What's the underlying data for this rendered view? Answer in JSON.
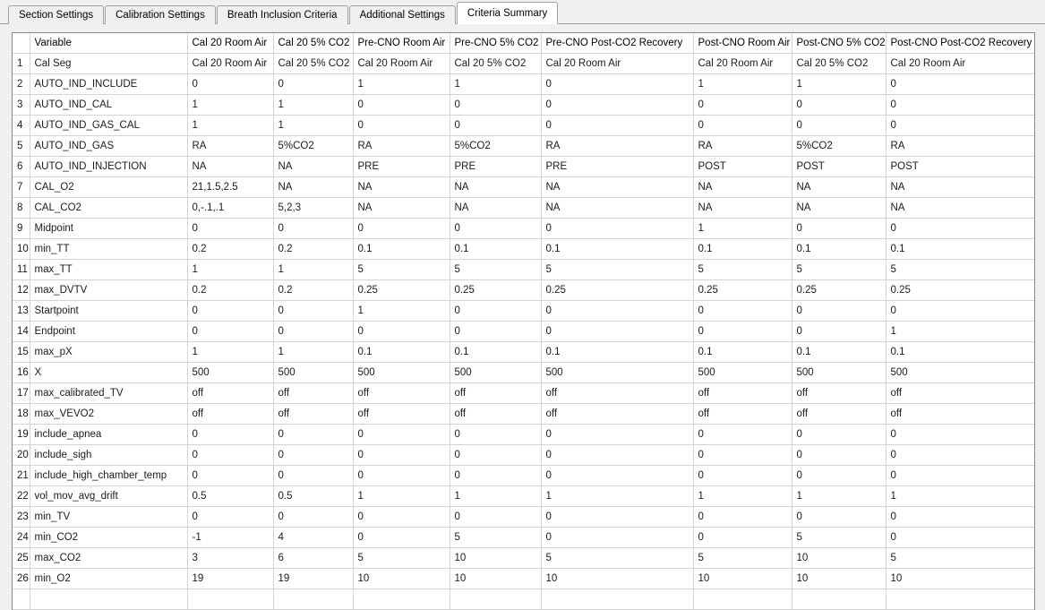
{
  "window": {
    "title": "Criteria Summary"
  },
  "tabs": [
    {
      "label": "Section Settings",
      "selected": false
    },
    {
      "label": "Calibration Settings",
      "selected": false
    },
    {
      "label": "Breath Inclusion Criteria",
      "selected": false
    },
    {
      "label": "Additional Settings",
      "selected": false
    },
    {
      "label": "Criteria Summary",
      "selected": true
    }
  ],
  "table": {
    "rownum_header": "",
    "variable_header": "Variable",
    "column_headers": [
      "Cal 20 Room Air",
      "Cal 20 5% CO2",
      "Pre-CNO Room Air",
      "Pre-CNO 5% CO2",
      "Pre-CNO Post-CO2 Recovery",
      "Post-CNO Room Air",
      "Post-CNO 5% CO2",
      "Post-CNO Post-CO2 Recovery"
    ],
    "rows": [
      {
        "num": "1",
        "variable": "Cal Seg",
        "values": [
          "Cal 20 Room Air",
          "Cal 20 5% CO2",
          "Cal 20 Room Air",
          "Cal 20 5% CO2",
          "Cal 20 Room Air",
          "Cal 20 Room Air",
          "Cal 20 5% CO2",
          "Cal 20 Room Air"
        ]
      },
      {
        "num": "2",
        "variable": "AUTO_IND_INCLUDE",
        "values": [
          "0",
          "0",
          "1",
          "1",
          "0",
          "1",
          "1",
          "0"
        ]
      },
      {
        "num": "3",
        "variable": "AUTO_IND_CAL",
        "values": [
          "1",
          "1",
          "0",
          "0",
          "0",
          "0",
          "0",
          "0"
        ]
      },
      {
        "num": "4",
        "variable": "AUTO_IND_GAS_CAL",
        "values": [
          "1",
          "1",
          "0",
          "0",
          "0",
          "0",
          "0",
          "0"
        ]
      },
      {
        "num": "5",
        "variable": "AUTO_IND_GAS",
        "values": [
          "RA",
          "5%CO2",
          "RA",
          "5%CO2",
          "RA",
          "RA",
          "5%CO2",
          "RA"
        ]
      },
      {
        "num": "6",
        "variable": "AUTO_IND_INJECTION",
        "values": [
          "NA",
          "NA",
          "PRE",
          "PRE",
          "PRE",
          "POST",
          "POST",
          "POST"
        ]
      },
      {
        "num": "7",
        "variable": "CAL_O2",
        "values": [
          "21,1.5,2.5",
          "NA",
          "NA",
          "NA",
          "NA",
          "NA",
          "NA",
          "NA"
        ]
      },
      {
        "num": "8",
        "variable": "CAL_CO2",
        "values": [
          "0,-.1,.1",
          "5,2,3",
          "NA",
          "NA",
          "NA",
          "NA",
          "NA",
          "NA"
        ]
      },
      {
        "num": "9",
        "variable": "Midpoint",
        "values": [
          "0",
          "0",
          "0",
          "0",
          "0",
          "1",
          "0",
          "0"
        ]
      },
      {
        "num": "10",
        "variable": "min_TT",
        "values": [
          "0.2",
          "0.2",
          "0.1",
          "0.1",
          "0.1",
          "0.1",
          "0.1",
          "0.1"
        ]
      },
      {
        "num": "11",
        "variable": "max_TT",
        "values": [
          "1",
          "1",
          "5",
          "5",
          "5",
          "5",
          "5",
          "5"
        ]
      },
      {
        "num": "12",
        "variable": "max_DVTV",
        "values": [
          "0.2",
          "0.2",
          "0.25",
          "0.25",
          "0.25",
          "0.25",
          "0.25",
          "0.25"
        ]
      },
      {
        "num": "13",
        "variable": "Startpoint",
        "values": [
          "0",
          "0",
          "1",
          "0",
          "0",
          "0",
          "0",
          "0"
        ]
      },
      {
        "num": "14",
        "variable": "Endpoint",
        "values": [
          "0",
          "0",
          "0",
          "0",
          "0",
          "0",
          "0",
          "1"
        ]
      },
      {
        "num": "15",
        "variable": "max_pX",
        "values": [
          "1",
          "1",
          "0.1",
          "0.1",
          "0.1",
          "0.1",
          "0.1",
          "0.1"
        ]
      },
      {
        "num": "16",
        "variable": "X",
        "values": [
          "500",
          "500",
          "500",
          "500",
          "500",
          "500",
          "500",
          "500"
        ]
      },
      {
        "num": "17",
        "variable": "max_calibrated_TV",
        "values": [
          "off",
          "off",
          "off",
          "off",
          "off",
          "off",
          "off",
          "off"
        ]
      },
      {
        "num": "18",
        "variable": "max_VEVO2",
        "values": [
          "off",
          "off",
          "off",
          "off",
          "off",
          "off",
          "off",
          "off"
        ]
      },
      {
        "num": "19",
        "variable": "include_apnea",
        "values": [
          "0",
          "0",
          "0",
          "0",
          "0",
          "0",
          "0",
          "0"
        ]
      },
      {
        "num": "20",
        "variable": "include_sigh",
        "values": [
          "0",
          "0",
          "0",
          "0",
          "0",
          "0",
          "0",
          "0"
        ]
      },
      {
        "num": "21",
        "variable": "include_high_chamber_temp",
        "values": [
          "0",
          "0",
          "0",
          "0",
          "0",
          "0",
          "0",
          "0"
        ]
      },
      {
        "num": "22",
        "variable": "vol_mov_avg_drift",
        "values": [
          "0.5",
          "0.5",
          "1",
          "1",
          "1",
          "1",
          "1",
          "1"
        ]
      },
      {
        "num": "23",
        "variable": "min_TV",
        "values": [
          "0",
          "0",
          "0",
          "0",
          "0",
          "0",
          "0",
          "0"
        ]
      },
      {
        "num": "24",
        "variable": "min_CO2",
        "values": [
          "-1",
          "4",
          "0",
          "5",
          "0",
          "0",
          "5",
          "0"
        ]
      },
      {
        "num": "25",
        "variable": "max_CO2",
        "values": [
          "3",
          "6",
          "5",
          "10",
          "5",
          "5",
          "10",
          "5"
        ]
      },
      {
        "num": "26",
        "variable": "min_O2",
        "values": [
          "19",
          "19",
          "10",
          "10",
          "10",
          "10",
          "10",
          "10"
        ]
      },
      {
        "num": "",
        "variable": "",
        "values": [
          "",
          "",
          "",
          "",
          "",
          "",
          "",
          ""
        ]
      }
    ]
  },
  "colors": {
    "window_background": "#f0f0f0",
    "grid_background": "#ffffff",
    "grid_line": "#d4d4d4",
    "grid_border": "#828790",
    "tab_border": "#a0a0a0",
    "text": "#1a1a1a"
  }
}
